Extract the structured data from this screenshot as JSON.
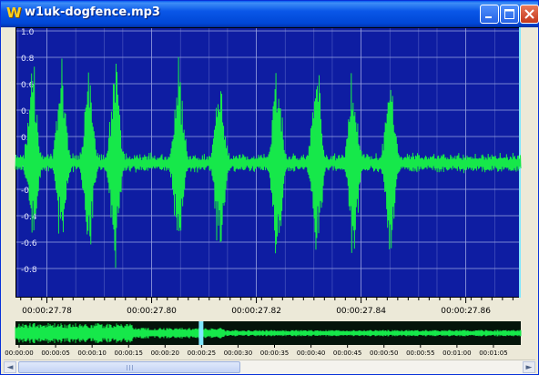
{
  "window": {
    "title": "w1uk-dogfence.mp3",
    "app_icon": "W",
    "buttons": {
      "minimize": "minimize-icon",
      "maximize": "maximize-icon",
      "close": "close-icon"
    }
  },
  "colors": {
    "plot_bg": "#0e1da2",
    "grid": "#9aa4e2",
    "waveform": "#16e84a",
    "overview_bg": "#04140a",
    "playhead": "#7fe7ff"
  },
  "chart_data": {
    "type": "line",
    "title": "",
    "ylim": [
      -1.0,
      1.0
    ],
    "y_ticks": [
      "1.0",
      "0.8",
      "0.6",
      "0.4",
      "0.2",
      "0",
      "-0.2",
      "-0.4",
      "-0.6",
      "-0.8"
    ],
    "x_ticks": [
      "00:00:27.78",
      "00:00:27.80",
      "00:00:27.82",
      "00:00:27.84",
      "00:00:27.86"
    ],
    "series": [
      {
        "bursts": [
          {
            "center": 27.7773,
            "peak": 0.85
          },
          {
            "center": 27.7828,
            "peak": 0.87
          },
          {
            "center": 27.788,
            "peak": 0.86
          },
          {
            "center": 27.793,
            "peak": 0.88
          },
          {
            "center": 27.8052,
            "peak": 0.88
          },
          {
            "center": 27.813,
            "peak": 0.86
          },
          {
            "center": 27.824,
            "peak": 0.87
          },
          {
            "center": 27.8315,
            "peak": 0.88
          },
          {
            "center": 27.8385,
            "peak": 0.85
          },
          {
            "center": 27.8455,
            "peak": 0.86
          }
        ]
      }
    ]
  },
  "overview": {
    "time_labels": [
      "00:00:00",
      "00:00:05",
      "00:00:10",
      "00:00:15",
      "00:00:20",
      "00:00:25",
      "00:00:30",
      "00:00:35",
      "00:00:40",
      "00:00:45",
      "00:00:50",
      "00:00:55",
      "00:01:00",
      "00:01:05"
    ],
    "playhead_time": "00:00:25"
  },
  "scrollbar": {
    "left_arrow": "◄",
    "right_arrow": "►"
  }
}
